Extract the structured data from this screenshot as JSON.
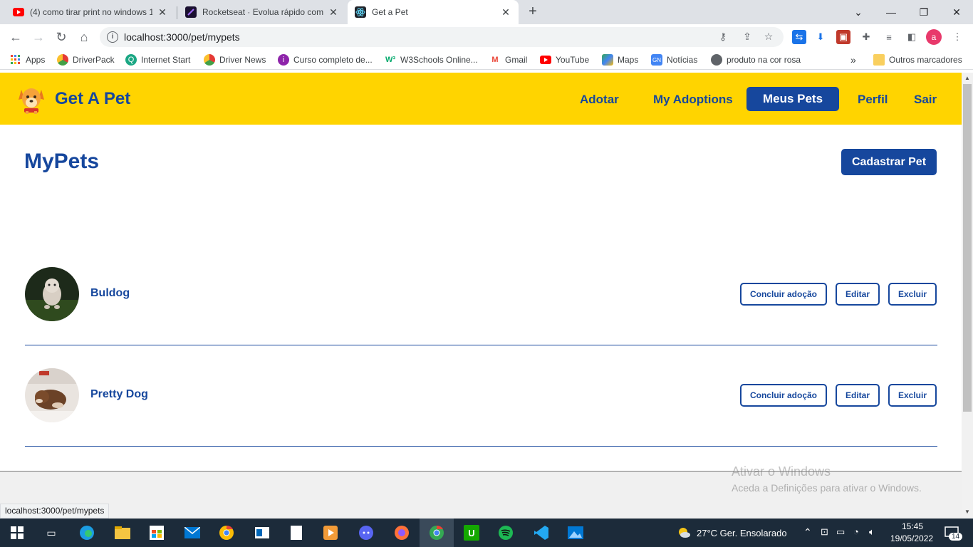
{
  "browser": {
    "tabs": [
      {
        "title": "(4) como tirar print no windows 1",
        "favicon": "youtube-icon"
      },
      {
        "title": "Rocketseat · Evolua rápido como",
        "favicon": "rocketseat-icon"
      },
      {
        "title": "Get a Pet",
        "favicon": "react-icon",
        "active": true
      }
    ],
    "url": "localhost:3000/pet/mypets",
    "bookmarks": [
      {
        "label": "Apps",
        "icon": "apps-grid-icon"
      },
      {
        "label": "DriverPack",
        "icon": "driverpack-icon"
      },
      {
        "label": "Internet Start",
        "icon": "internet-start-icon"
      },
      {
        "label": "Driver News",
        "icon": "driver-news-icon"
      },
      {
        "label": "Curso completo de...",
        "icon": "curso-icon"
      },
      {
        "label": "W3Schools Online...",
        "icon": "w3schools-icon"
      },
      {
        "label": "Gmail",
        "icon": "gmail-icon"
      },
      {
        "label": "YouTube",
        "icon": "youtube-icon"
      },
      {
        "label": "Maps",
        "icon": "maps-icon"
      },
      {
        "label": "Notícias",
        "icon": "news-icon"
      },
      {
        "label": "produto na cor rosa",
        "icon": "globe-icon"
      }
    ],
    "other_bookmarks": "Outros marcadores",
    "profile_initial": "a",
    "status_url": "localhost:3000/pet/mypets"
  },
  "app": {
    "brand": "Get A Pet",
    "nav": {
      "adotar": "Adotar",
      "my_adoptions": "My Adoptions",
      "meus_pets": "Meus Pets",
      "perfil": "Perfil",
      "sair": "Sair"
    },
    "page_title": "MyPets",
    "register_button": "Cadastrar Pet",
    "pets": [
      {
        "name": "Buldog",
        "conclude": "Concluir adoção",
        "edit": "Editar",
        "delete": "Excluir"
      },
      {
        "name": "Pretty Dog",
        "conclude": "Concluir adoção",
        "edit": "Editar",
        "delete": "Excluir"
      }
    ],
    "colors": {
      "primary": "#16479d",
      "accent": "#ffd400"
    }
  },
  "windows": {
    "watermark_title": "Ativar o Windows",
    "watermark_sub": "Aceda a Definições para ativar o Windows.",
    "weather": "27°C  Ger. Ensolarado",
    "time": "15:45",
    "date": "19/05/2022",
    "notifications": "14"
  }
}
